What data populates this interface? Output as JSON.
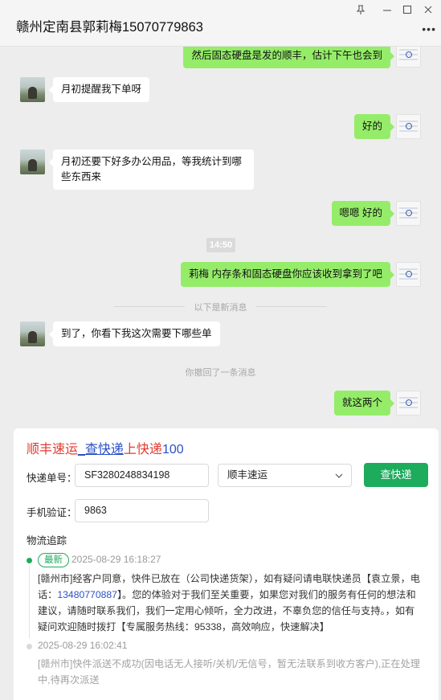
{
  "window": {
    "title": "赣州定南县郭莉梅15070779863",
    "pin_icon": "pin-icon",
    "minimize_icon": "minimize-icon",
    "maximize_icon": "maximize-icon",
    "close_icon": "close-icon",
    "more_icon": "more-icon"
  },
  "chat": {
    "messages": [
      {
        "side": "right",
        "text": "然后固态硬盘是发的顺丰，估计下午也会到"
      },
      {
        "side": "left",
        "text": "月初提醒我下单呀"
      },
      {
        "side": "right",
        "text": "好的"
      },
      {
        "side": "left",
        "text": "月初还要下好多办公用品，等我统计到哪些东西来"
      },
      {
        "side": "right",
        "text": "嗯嗯 好的"
      },
      {
        "side": "right",
        "text": "莉梅   内存条和固态硬盘你应该收到拿到了吧"
      },
      {
        "side": "left",
        "text": "到了，你看下我这次需要下哪些单"
      },
      {
        "side": "right",
        "text": "就这两个"
      }
    ],
    "timestamp": "14:50",
    "new_messages_divider": "以下是新消息",
    "recall_notice": "你撤回了一条消息"
  },
  "card": {
    "site_name_parts": [
      "顺丰速运",
      "_查快递",
      "上快递",
      "100"
    ],
    "tracking_label": "快递单号：",
    "tracking_value": "SF3280248834198",
    "carrier_value": "顺丰速运",
    "query_button": "查快递",
    "phone_label": "手机验证：",
    "phone_value": "9863",
    "section_title": "物流追踪",
    "events": [
      {
        "badge": "最新",
        "time": "2025-08-29 16:18:27",
        "text_before": "[赣州市]经客户同意，快件已放在（公司快递货架），如有疑问请电联快递员【袁立景，电话：",
        "phone": "13480770887",
        "text_after": "】。您的体验对于我们至关重要，如果您对我们的服务有任何的想法和建议，请随时联系我们，我们一定用心倾听，全力改进，不辜负您的信任与支持。，如有疑问欢迎随时拨打【专属服务热线：95338，高效响应，快速解决】"
      },
      {
        "time": "2025-08-29 16:02:41",
        "text": "[赣州市]快件派送不成功(因电话无人接听/关机/无信号，暂无法联系到收方客户),正在处理中,待再次派送"
      }
    ]
  },
  "colors": {
    "bubble_self": "#95ec69",
    "bubble_other": "#ffffff",
    "accent_green": "#1dab5c",
    "logo_red": "#e23b32",
    "logo_blue": "#2b50c8"
  }
}
